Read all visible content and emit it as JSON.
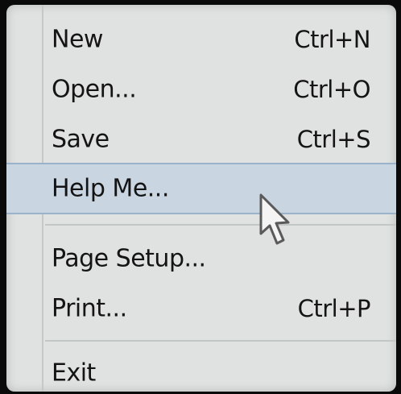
{
  "menu": {
    "items": [
      {
        "label": "New",
        "shortcut": "Ctrl+N"
      },
      {
        "label": "Open...",
        "shortcut": "Ctrl+O"
      },
      {
        "label": "Save",
        "shortcut": "Ctrl+S"
      },
      {
        "label": "Help Me...",
        "shortcut": ""
      },
      {
        "label": "Page Setup...",
        "shortcut": ""
      },
      {
        "label": "Print...",
        "shortcut": "Ctrl+P"
      },
      {
        "label": "Exit",
        "shortcut": ""
      }
    ],
    "highlighted_item": "Help Me...",
    "colors": {
      "background": "#dfe2e1",
      "highlight": "#c9d6e2",
      "highlight_border": "#9ab3cb",
      "text": "#141414"
    }
  },
  "cursor": {
    "icon": "arrow-pointer-icon"
  }
}
